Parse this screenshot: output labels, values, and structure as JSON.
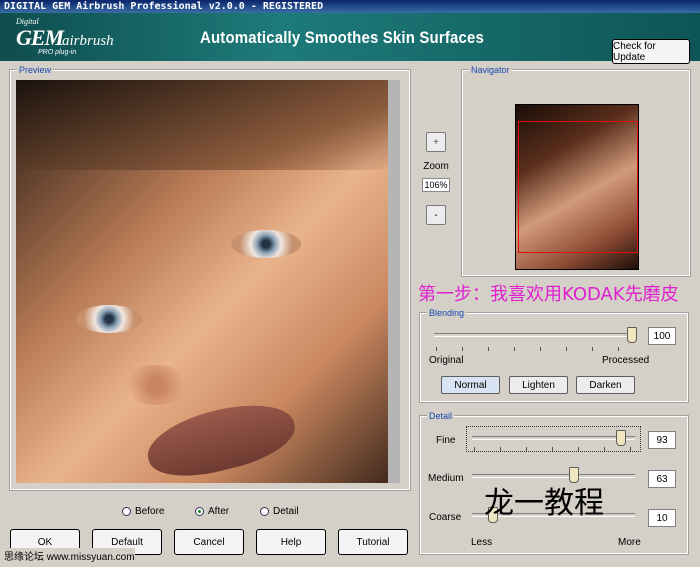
{
  "window": {
    "title": "DIGITAL GEM Airbrush Professional v2.0.0 - REGISTERED"
  },
  "banner": {
    "logo_digital": "Digital",
    "logo_gem": "GEM",
    "logo_airbrush": "airbrush",
    "logo_plugin": "PRO plug-in",
    "tagline": "Automatically Smoothes Skin Surfaces",
    "check_update_label": "Check for Update"
  },
  "preview": {
    "title": "Preview"
  },
  "zoom": {
    "plus": "+",
    "minus": "-",
    "label": "Zoom",
    "value": "106%"
  },
  "navigator": {
    "title": "Navigator"
  },
  "note_cn": "第一步：我喜欢用KODAK先磨皮",
  "blending": {
    "title": "Blending",
    "value": "100",
    "left_label": "Original",
    "right_label": "Processed",
    "modes": [
      "Normal",
      "Lighten",
      "Darken"
    ]
  },
  "detail": {
    "title": "Detail",
    "fine_label": "Fine",
    "fine_value": "93",
    "medium_label": "Medium",
    "medium_value": "63",
    "coarse_label": "Coarse",
    "coarse_value": "10",
    "less_label": "Less",
    "more_label": "More"
  },
  "view_options": {
    "before": "Before",
    "after": "After",
    "detail": "Detail",
    "selected": "After"
  },
  "buttons": {
    "ok": "OK",
    "default": "Default",
    "cancel": "Cancel",
    "help": "Help",
    "tutorial": "Tutorial"
  },
  "watermark_cn": "龙一教程",
  "footer_watermark": "思缘论坛  www.missyuan.com",
  "colors": {
    "banner": "#1e7b7a",
    "group_title": "#1a48b0",
    "note": "#e020d0",
    "nav_rect": "#e01010"
  }
}
